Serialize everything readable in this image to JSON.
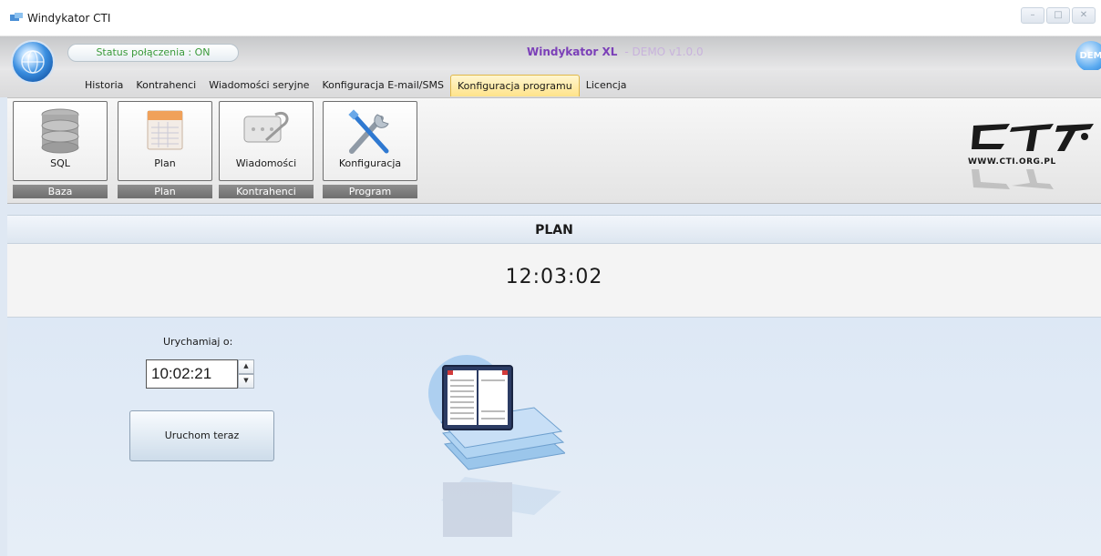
{
  "window": {
    "title": "Windykator CTI",
    "controls": [
      "minimize-icon",
      "maximize-icon",
      "close-icon"
    ]
  },
  "header": {
    "status": "Status połączenia : ON",
    "app_name": "Windykator XL",
    "app_version": "- DEMO v1.0.0",
    "badge": "DEM"
  },
  "tabs": [
    {
      "label": "Historia"
    },
    {
      "label": "Kontrahenci"
    },
    {
      "label": "Wiadomości seryjne"
    },
    {
      "label": "Konfiguracja E-mail/SMS"
    },
    {
      "label": "Konfiguracja programu",
      "active": true
    },
    {
      "label": "Licencja"
    }
  ],
  "ribbon": {
    "buttons": [
      {
        "label": "SQL",
        "icon": "database-icon"
      },
      {
        "label": "Plan",
        "icon": "calendar-icon"
      },
      {
        "label": "Wiadomości",
        "icon": "message-icon"
      },
      {
        "label": "Konfiguracja",
        "icon": "tools-icon"
      }
    ],
    "groups": [
      {
        "label": "Baza"
      },
      {
        "label": "Plan"
      },
      {
        "label": "Kontrahenci"
      },
      {
        "label": "Program"
      }
    ],
    "logo_url": "WWW.CTI.ORG.PL"
  },
  "content": {
    "title": "PLAN",
    "clock": "12:03:02",
    "run_label": "Urychamiaj o:",
    "run_time": "10:02:21",
    "run_now_button": "Uruchom teraz"
  }
}
